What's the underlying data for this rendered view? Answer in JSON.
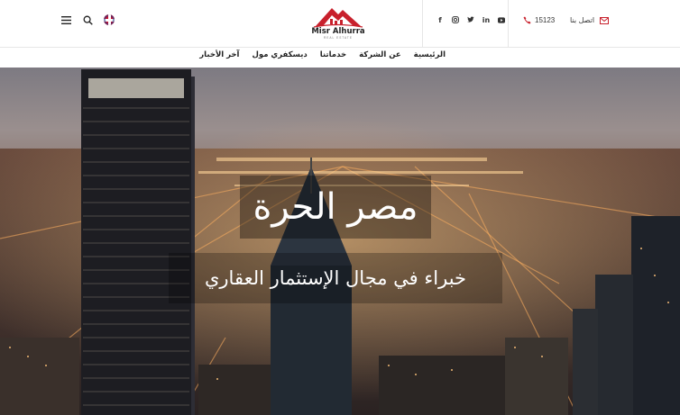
{
  "header": {
    "logo_name": "Misr Alhurra",
    "logo_tagline": "REAL ESTATE",
    "phone_number": "15123",
    "contact_label": "اتصل بنا",
    "social": [
      "facebook-icon",
      "instagram-icon",
      "twitter-icon",
      "linkedin-icon",
      "youtube-icon"
    ],
    "tools": [
      "menu-icon",
      "search-icon",
      "uk-flag-icon"
    ]
  },
  "nav": {
    "items": [
      {
        "label": "الرئيسية"
      },
      {
        "label": "عن الشركة"
      },
      {
        "label": "خدماتنا"
      },
      {
        "label": "ديسكفري مول"
      },
      {
        "label": "آخر الأخبار"
      }
    ]
  },
  "hero": {
    "title": "مصر الحرة",
    "subtitle": "خبراء في مجال الإستثمار العقاري"
  },
  "colors": {
    "brand_red": "#c8202c",
    "text_dark": "#222222",
    "phone_red": "#c8202c"
  }
}
